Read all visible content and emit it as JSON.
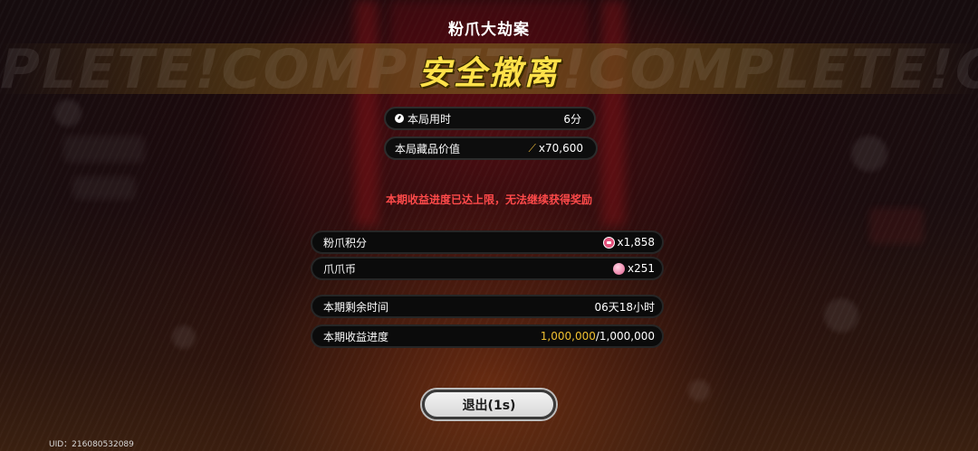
{
  "background_text": "PLETE!COMPLETE!COMPLETE!COMPLE",
  "event_title": "粉爪大劫案",
  "result_title": "安全撤离",
  "summary": {
    "time_label": "本局用时",
    "time_value": "6分",
    "collection_label": "本局藏品价值",
    "collection_value": "x70,600"
  },
  "warning": "本期收益进度已达上限，无法继续获得奖励",
  "rewards": [
    {
      "label": "粉爪积分",
      "value": "x1,858",
      "icon": "pink-claw-token-icon"
    },
    {
      "label": "爪爪币",
      "value": "x251",
      "icon": "pink-coin-icon"
    }
  ],
  "period": {
    "remaining_label": "本期剩余时间",
    "remaining_value": "06天18小时",
    "progress_label": "本期收益进度",
    "progress_current": "1,000,000",
    "progress_max": "/1,000,000"
  },
  "exit_button": "退出(1s)",
  "uid": "UID：216080532089",
  "colors": {
    "title_yellow": "#ffe14a",
    "warning_red": "#ff4a4a",
    "progress_gold": "#f0c030"
  }
}
